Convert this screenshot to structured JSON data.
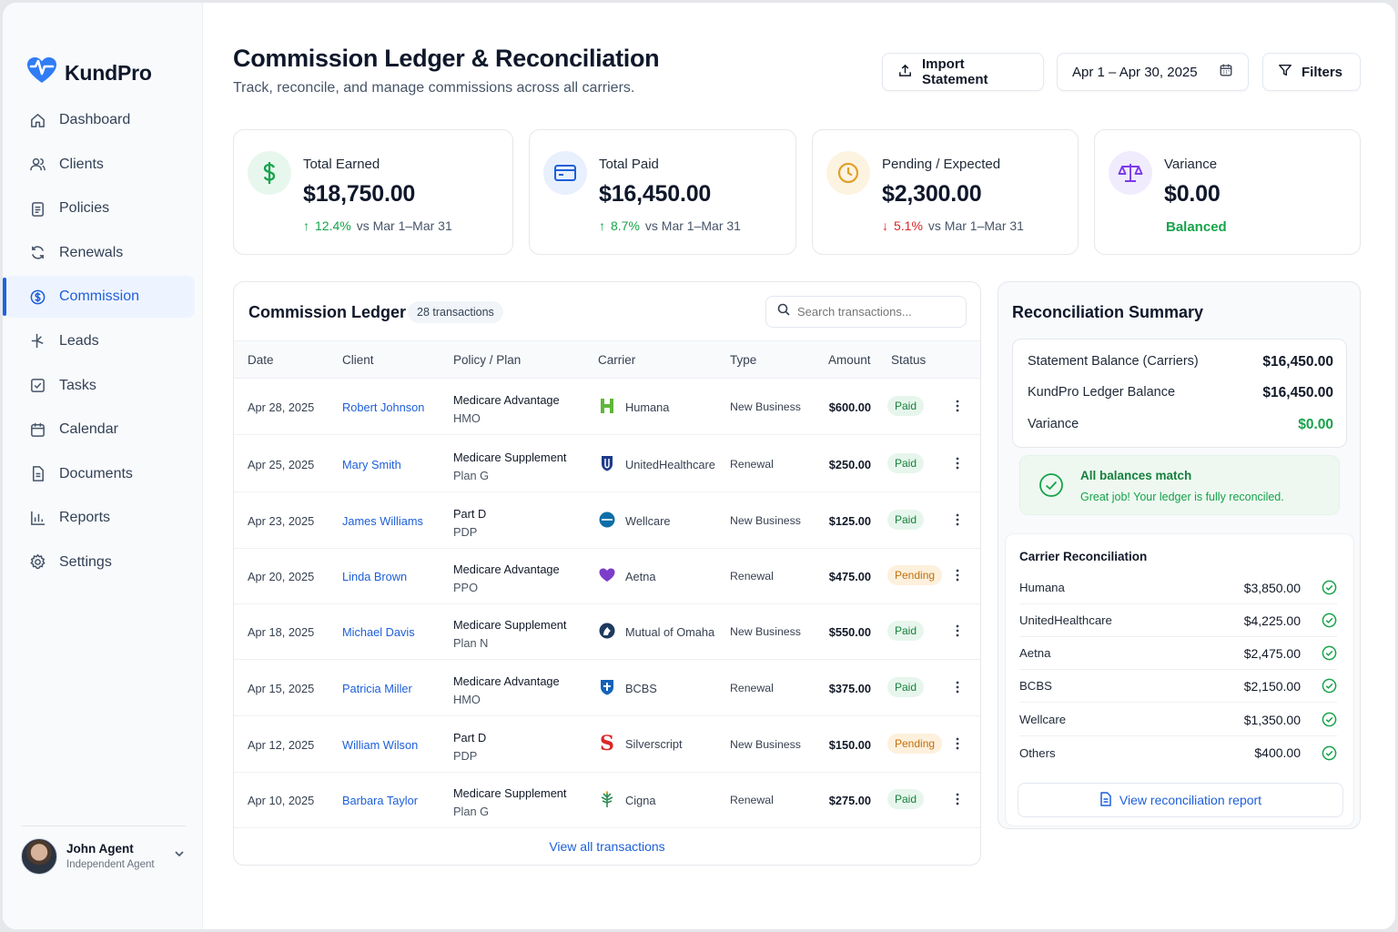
{
  "brand": {
    "name": "KundPro"
  },
  "nav": [
    {
      "label": "Dashboard",
      "icon": "home-icon"
    },
    {
      "label": "Clients",
      "icon": "users-icon"
    },
    {
      "label": "Policies",
      "icon": "clipboard-icon"
    },
    {
      "label": "Renewals",
      "icon": "refresh-icon"
    },
    {
      "label": "Commission",
      "icon": "dollar-circle-icon",
      "active": true
    },
    {
      "label": "Leads",
      "icon": "sparkle-icon"
    },
    {
      "label": "Tasks",
      "icon": "checkbox-icon"
    },
    {
      "label": "Calendar",
      "icon": "calendar-icon"
    },
    {
      "label": "Documents",
      "icon": "document-icon"
    },
    {
      "label": "Reports",
      "icon": "bar-chart-icon"
    },
    {
      "label": "Settings",
      "icon": "gear-icon"
    }
  ],
  "user": {
    "name": "John Agent",
    "role": "Independent Agent"
  },
  "header": {
    "title": "Commission Ledger & Reconciliation",
    "subtitle": "Track, reconcile, and manage commissions across all carriers.",
    "import_label": "Import Statement",
    "date_range": "Apr 1 – Apr 30, 2025",
    "filters_label": "Filters"
  },
  "kpis": {
    "earned": {
      "label": "Total Earned",
      "value": "$18,750.00",
      "delta": "12.4%",
      "compare": "vs Mar 1–Mar 31"
    },
    "paid": {
      "label": "Total Paid",
      "value": "$16,450.00",
      "delta": "8.7%",
      "compare": "vs Mar 1–Mar 31"
    },
    "pending": {
      "label": "Pending / Expected",
      "value": "$2,300.00",
      "delta": "5.1%",
      "compare": "vs Mar 1–Mar 31"
    },
    "variance": {
      "label": "Variance",
      "value": "$0.00",
      "status": "Balanced"
    }
  },
  "ledger": {
    "title": "Commission Ledger",
    "count": "28 transactions",
    "search_placeholder": "Search transactions...",
    "columns": [
      "Date",
      "Client",
      "Policy / Plan",
      "Carrier",
      "Type",
      "Amount",
      "Status"
    ],
    "rows": [
      {
        "date": "Apr 28, 2025",
        "client": "Robert Johnson",
        "plan1": "Medicare Advantage",
        "plan2": "HMO",
        "carrier": "Humana",
        "logo": "humana-logo",
        "type": "New Business",
        "amount": "$600.00",
        "status": "Paid"
      },
      {
        "date": "Apr 25, 2025",
        "client": "Mary Smith",
        "plan1": "Medicare Supplement",
        "plan2": "Plan G",
        "carrier": "UnitedHealthcare",
        "logo": "unitedhealthcare-logo",
        "type": "Renewal",
        "amount": "$250.00",
        "status": "Paid"
      },
      {
        "date": "Apr 23, 2025",
        "client": "James Williams",
        "plan1": "Part D",
        "plan2": "PDP",
        "carrier": "Wellcare",
        "logo": "wellcare-logo",
        "type": "New Business",
        "amount": "$125.00",
        "status": "Paid"
      },
      {
        "date": "Apr 20, 2025",
        "client": "Linda Brown",
        "plan1": "Medicare Advantage",
        "plan2": "PPO",
        "carrier": "Aetna",
        "logo": "aetna-logo",
        "type": "Renewal",
        "amount": "$475.00",
        "status": "Pending"
      },
      {
        "date": "Apr 18, 2025",
        "client": "Michael Davis",
        "plan1": "Medicare Supplement",
        "plan2": "Plan N",
        "carrier": "Mutual of Omaha",
        "logo": "mutual-of-omaha-logo",
        "type": "New Business",
        "amount": "$550.00",
        "status": "Paid"
      },
      {
        "date": "Apr 15, 2025",
        "client": "Patricia Miller",
        "plan1": "Medicare Advantage",
        "plan2": "HMO",
        "carrier": "BCBS",
        "logo": "bcbs-logo",
        "type": "Renewal",
        "amount": "$375.00",
        "status": "Paid"
      },
      {
        "date": "Apr 12, 2025",
        "client": "William Wilson",
        "plan1": "Part D",
        "plan2": "PDP",
        "carrier": "Silverscript",
        "logo": "silverscript-logo",
        "type": "New Business",
        "amount": "$150.00",
        "status": "Pending"
      },
      {
        "date": "Apr 10, 2025",
        "client": "Barbara Taylor",
        "plan1": "Medicare Supplement",
        "plan2": "Plan G",
        "carrier": "Cigna",
        "logo": "cigna-logo",
        "type": "Renewal",
        "amount": "$275.00",
        "status": "Paid"
      }
    ],
    "view_all": "View all transactions"
  },
  "recon": {
    "title": "Reconciliation Summary",
    "balances": [
      {
        "label": "Statement Balance (Carriers)",
        "value": "$16,450.00"
      },
      {
        "label": "KundPro Ledger Balance",
        "value": "$16,450.00"
      },
      {
        "label": "Variance",
        "value": "$0.00"
      }
    ],
    "match_title": "All balances match",
    "match_sub": "Great job! Your ledger is fully reconciled.",
    "carrier_title": "Carrier Reconciliation",
    "carriers": [
      {
        "name": "Humana",
        "amount": "$3,850.00"
      },
      {
        "name": "UnitedHealthcare",
        "amount": "$4,225.00"
      },
      {
        "name": "Aetna",
        "amount": "$2,475.00"
      },
      {
        "name": "BCBS",
        "amount": "$2,150.00"
      },
      {
        "name": "Wellcare",
        "amount": "$1,350.00"
      },
      {
        "name": "Others",
        "amount": "$400.00"
      }
    ],
    "report_label": "View reconciliation report"
  },
  "colors": {
    "accent": "#1d5fd9",
    "success": "#16a34a",
    "danger": "#dc2626",
    "warning": "#c2700d"
  }
}
